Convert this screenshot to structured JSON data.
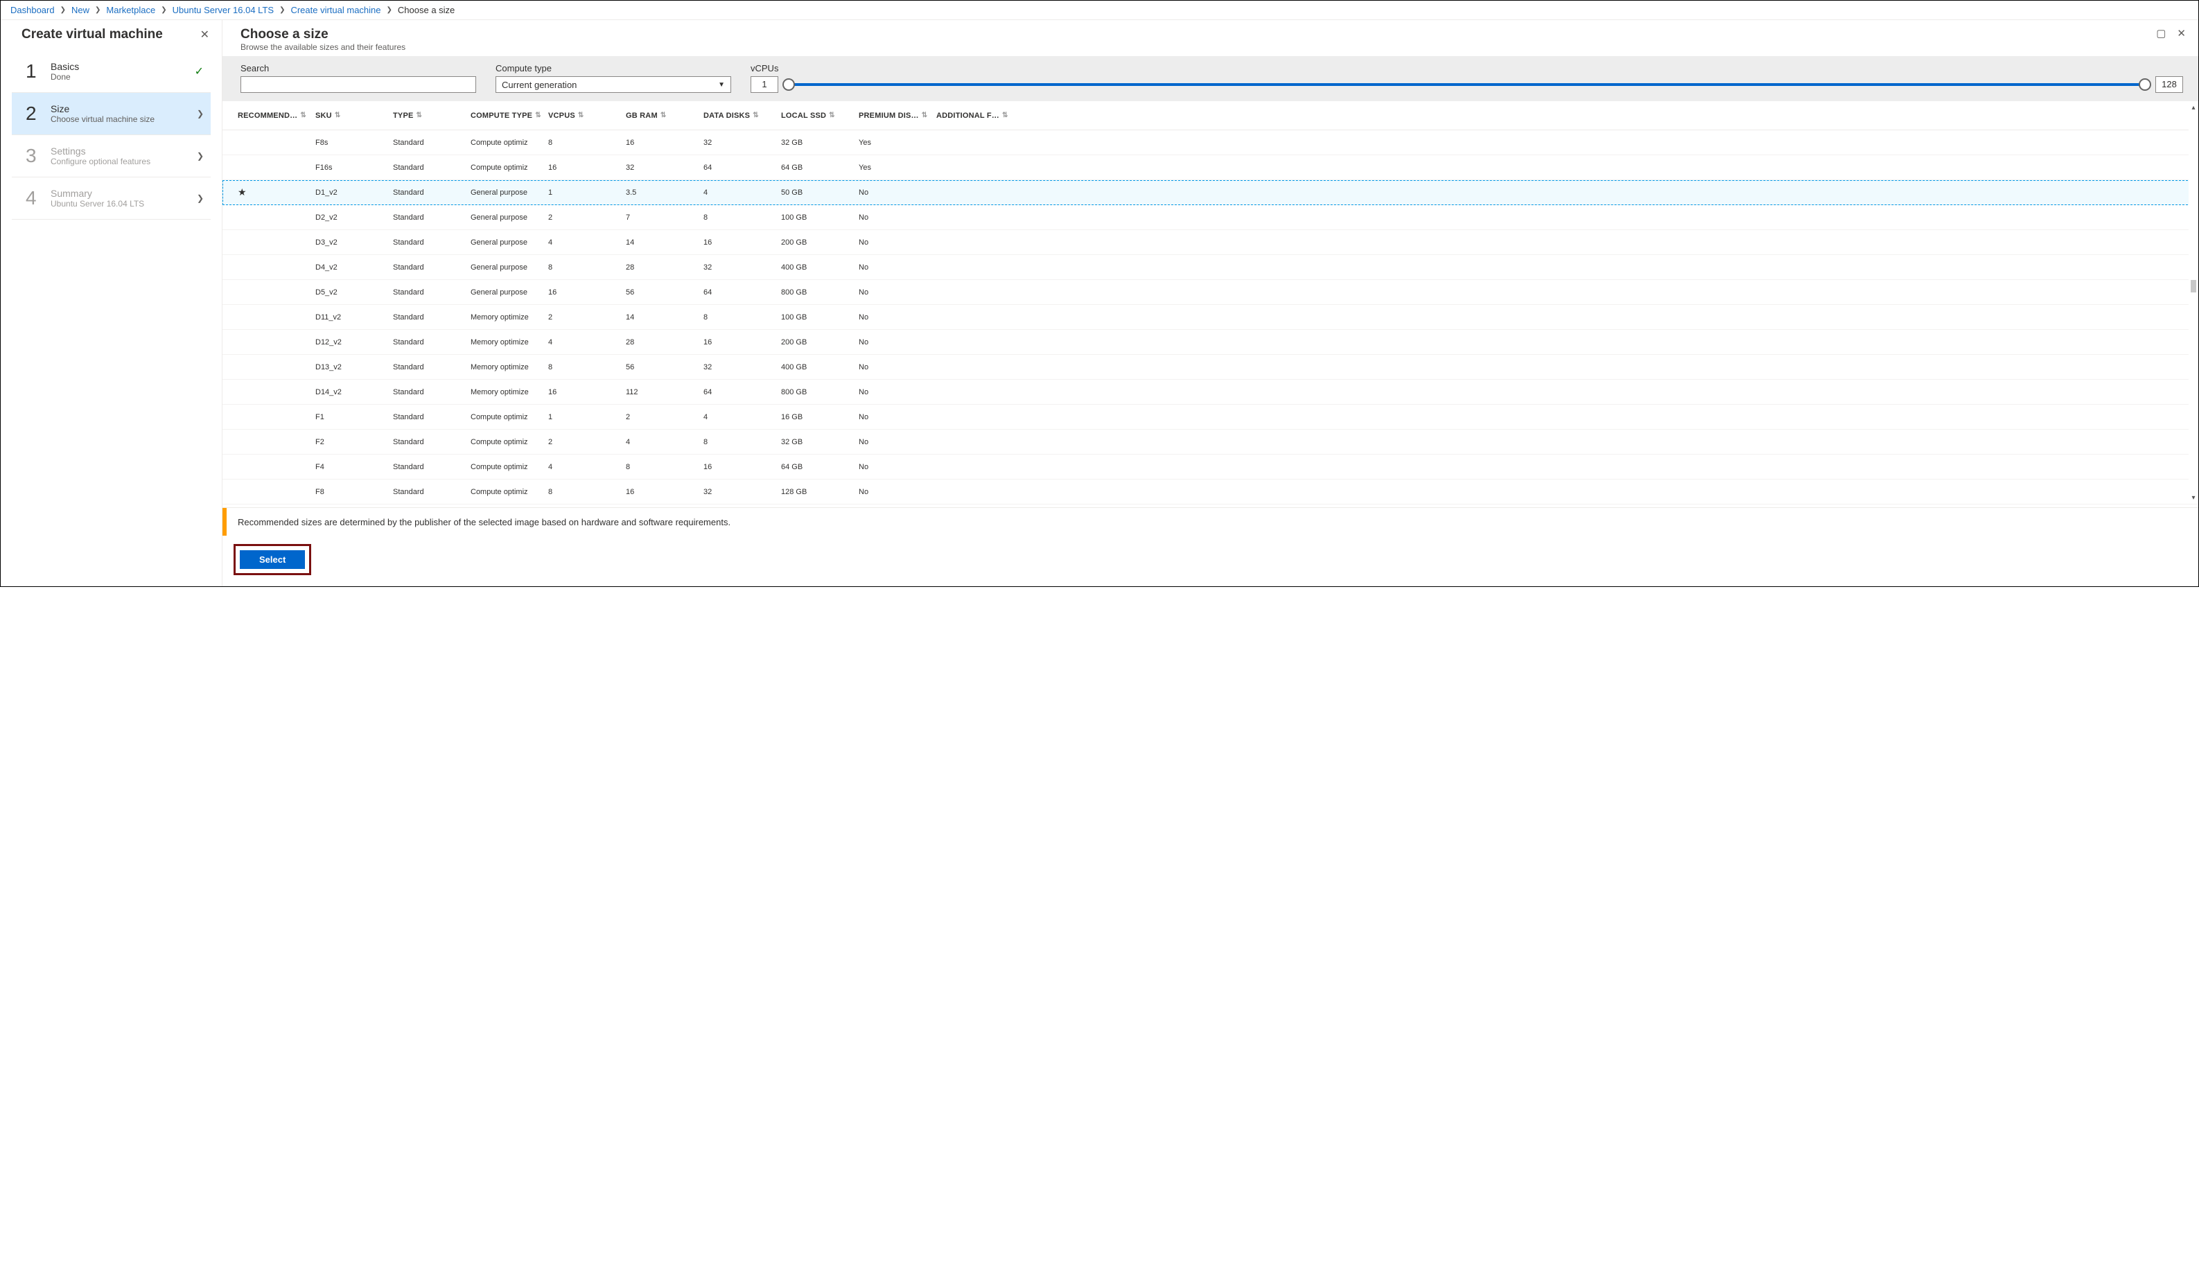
{
  "breadcrumbs": {
    "items": [
      {
        "label": "Dashboard",
        "link": true
      },
      {
        "label": "New",
        "link": true
      },
      {
        "label": "Marketplace",
        "link": true
      },
      {
        "label": "Ubuntu Server 16.04 LTS",
        "link": true
      },
      {
        "label": "Create virtual machine",
        "link": true
      },
      {
        "label": "Choose a size",
        "link": false
      }
    ]
  },
  "left": {
    "title": "Create virtual machine",
    "steps": [
      {
        "num": "1",
        "title": "Basics",
        "sub": "Done",
        "state": "done"
      },
      {
        "num": "2",
        "title": "Size",
        "sub": "Choose virtual machine size",
        "state": "active"
      },
      {
        "num": "3",
        "title": "Settings",
        "sub": "Configure optional features",
        "state": "disabled"
      },
      {
        "num": "4",
        "title": "Summary",
        "sub": "Ubuntu Server 16.04 LTS",
        "state": "disabled"
      }
    ]
  },
  "right": {
    "title": "Choose a size",
    "subtitle": "Browse the available sizes and their features",
    "filters": {
      "search_label": "Search",
      "search_value": "",
      "compute_label": "Compute type",
      "compute_value": "Current generation",
      "vcpu_label": "vCPUs",
      "vcpu_min": "1",
      "vcpu_max": "128"
    },
    "columns": {
      "rec": "RECOMMEND…",
      "sku": "SKU",
      "type": "TYPE",
      "ctype": "COMPUTE TYPE",
      "vcpu": "VCPUS",
      "ram": "GB RAM",
      "disks": "DATA DISKS",
      "ssd": "LOCAL SSD",
      "prem": "PREMIUM DIS…",
      "add": "ADDITIONAL F…"
    },
    "rows": [
      {
        "rec": "",
        "sku": "F8s",
        "type": "Standard",
        "ctype": "Compute optimiz",
        "vcpu": "8",
        "ram": "16",
        "disks": "32",
        "ssd": "32 GB",
        "prem": "Yes",
        "add": "",
        "sel": false
      },
      {
        "rec": "",
        "sku": "F16s",
        "type": "Standard",
        "ctype": "Compute optimiz",
        "vcpu": "16",
        "ram": "32",
        "disks": "64",
        "ssd": "64 GB",
        "prem": "Yes",
        "add": "",
        "sel": false
      },
      {
        "rec": "★",
        "sku": "D1_v2",
        "type": "Standard",
        "ctype": "General purpose",
        "vcpu": "1",
        "ram": "3.5",
        "disks": "4",
        "ssd": "50 GB",
        "prem": "No",
        "add": "",
        "sel": true
      },
      {
        "rec": "",
        "sku": "D2_v2",
        "type": "Standard",
        "ctype": "General purpose",
        "vcpu": "2",
        "ram": "7",
        "disks": "8",
        "ssd": "100 GB",
        "prem": "No",
        "add": "",
        "sel": false
      },
      {
        "rec": "",
        "sku": "D3_v2",
        "type": "Standard",
        "ctype": "General purpose",
        "vcpu": "4",
        "ram": "14",
        "disks": "16",
        "ssd": "200 GB",
        "prem": "No",
        "add": "",
        "sel": false
      },
      {
        "rec": "",
        "sku": "D4_v2",
        "type": "Standard",
        "ctype": "General purpose",
        "vcpu": "8",
        "ram": "28",
        "disks": "32",
        "ssd": "400 GB",
        "prem": "No",
        "add": "",
        "sel": false
      },
      {
        "rec": "",
        "sku": "D5_v2",
        "type": "Standard",
        "ctype": "General purpose",
        "vcpu": "16",
        "ram": "56",
        "disks": "64",
        "ssd": "800 GB",
        "prem": "No",
        "add": "",
        "sel": false
      },
      {
        "rec": "",
        "sku": "D11_v2",
        "type": "Standard",
        "ctype": "Memory optimize",
        "vcpu": "2",
        "ram": "14",
        "disks": "8",
        "ssd": "100 GB",
        "prem": "No",
        "add": "",
        "sel": false
      },
      {
        "rec": "",
        "sku": "D12_v2",
        "type": "Standard",
        "ctype": "Memory optimize",
        "vcpu": "4",
        "ram": "28",
        "disks": "16",
        "ssd": "200 GB",
        "prem": "No",
        "add": "",
        "sel": false
      },
      {
        "rec": "",
        "sku": "D13_v2",
        "type": "Standard",
        "ctype": "Memory optimize",
        "vcpu": "8",
        "ram": "56",
        "disks": "32",
        "ssd": "400 GB",
        "prem": "No",
        "add": "",
        "sel": false
      },
      {
        "rec": "",
        "sku": "D14_v2",
        "type": "Standard",
        "ctype": "Memory optimize",
        "vcpu": "16",
        "ram": "112",
        "disks": "64",
        "ssd": "800 GB",
        "prem": "No",
        "add": "",
        "sel": false
      },
      {
        "rec": "",
        "sku": "F1",
        "type": "Standard",
        "ctype": "Compute optimiz",
        "vcpu": "1",
        "ram": "2",
        "disks": "4",
        "ssd": "16 GB",
        "prem": "No",
        "add": "",
        "sel": false
      },
      {
        "rec": "",
        "sku": "F2",
        "type": "Standard",
        "ctype": "Compute optimiz",
        "vcpu": "2",
        "ram": "4",
        "disks": "8",
        "ssd": "32 GB",
        "prem": "No",
        "add": "",
        "sel": false
      },
      {
        "rec": "",
        "sku": "F4",
        "type": "Standard",
        "ctype": "Compute optimiz",
        "vcpu": "4",
        "ram": "8",
        "disks": "16",
        "ssd": "64 GB",
        "prem": "No",
        "add": "",
        "sel": false
      },
      {
        "rec": "",
        "sku": "F8",
        "type": "Standard",
        "ctype": "Compute optimiz",
        "vcpu": "8",
        "ram": "16",
        "disks": "32",
        "ssd": "128 GB",
        "prem": "No",
        "add": "",
        "sel": false
      }
    ],
    "info": "Recommended sizes are determined by the publisher of the selected image based on hardware and software requirements.",
    "select_label": "Select"
  }
}
